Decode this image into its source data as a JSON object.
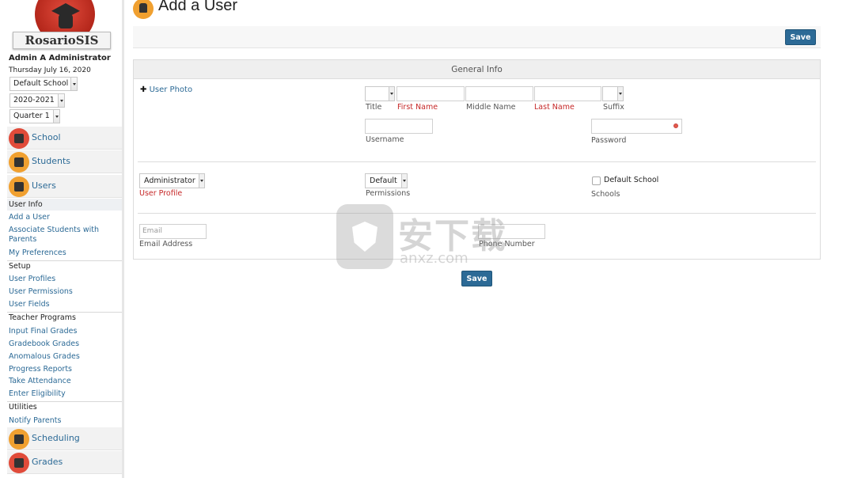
{
  "sidebar": {
    "logo_text": "RosarioSIS",
    "user_name": "Admin A Administrator",
    "date": "Thursday July 16, 2020",
    "school_select": "Default School",
    "year_select": "2020-2021",
    "period_select": "Quarter 1",
    "modules": {
      "school": "School",
      "students": "Students",
      "users": "Users",
      "scheduling": "Scheduling",
      "grades": "Grades"
    },
    "users_menu": {
      "user_info": "User Info",
      "add_user": "Add a User",
      "associate_line1": "Associate Students with",
      "associate_line2": "Parents",
      "my_preferences": "My Preferences",
      "setup": "Setup",
      "user_profiles": "User Profiles",
      "user_permissions": "User Permissions",
      "user_fields": "User Fields",
      "teacher_programs": "Teacher Programs",
      "input_final_grades": "Input Final Grades",
      "gradebook_grades": "Gradebook Grades",
      "anomalous_grades": "Anomalous Grades",
      "progress_reports": "Progress Reports",
      "take_attendance": "Take Attendance",
      "enter_eligibility": "Enter Eligibility",
      "utilities": "Utilities",
      "notify_parents": "Notify Parents"
    }
  },
  "main": {
    "title": "Add a User",
    "save_label": "Save",
    "panel_title": "General Info",
    "user_photo": "User Photo",
    "labels": {
      "title": "Title",
      "first_name": "First Name",
      "middle_name": "Middle Name",
      "last_name": "Last Name",
      "suffix": "Suffix",
      "username": "Username",
      "password": "Password",
      "user_profile": "User Profile",
      "permissions": "Permissions",
      "schools": "Schools",
      "email_address": "Email Address",
      "phone_number": "Phone Number"
    },
    "values": {
      "user_profile": "Administrator",
      "permissions": "Default",
      "default_school": "Default School"
    },
    "placeholders": {
      "email": "Email"
    }
  },
  "watermark": {
    "big": "安下载",
    "small": "anxz.com"
  },
  "colors": {
    "link": "#2c6a96",
    "required": "#c62828",
    "button": "#2c6a96"
  }
}
